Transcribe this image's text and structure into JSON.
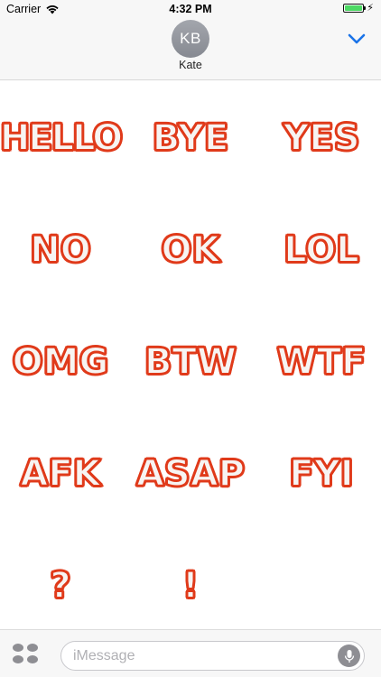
{
  "status_bar": {
    "carrier": "Carrier",
    "time": "4:32 PM",
    "battery_level": 1.0,
    "charging_icon": "bolt-icon",
    "signal_icon": "wifi-icon"
  },
  "header": {
    "avatar_initials": "KB",
    "contact_name": "Kate",
    "collapse_icon": "chevron-down-icon"
  },
  "stickers": [
    {
      "label": "HELLO"
    },
    {
      "label": "BYE"
    },
    {
      "label": "YES"
    },
    {
      "label": "NO"
    },
    {
      "label": "OK"
    },
    {
      "label": "LOL"
    },
    {
      "label": "OMG"
    },
    {
      "label": "BTW"
    },
    {
      "label": "WTF"
    },
    {
      "label": "AFK"
    },
    {
      "label": "ASAP"
    },
    {
      "label": "FYI"
    },
    {
      "label": "?"
    },
    {
      "label": "!"
    }
  ],
  "bottom_bar": {
    "apps_icon": "app-drawer-icon",
    "input_placeholder": "iMessage",
    "input_value": "",
    "mic_icon": "microphone-icon"
  },
  "colors": {
    "sticker_outline": "#e03a1a",
    "sticker_fill": "#f7f4f2",
    "accent_blue": "#1a73e8",
    "bar_background": "#f7f7f7"
  }
}
